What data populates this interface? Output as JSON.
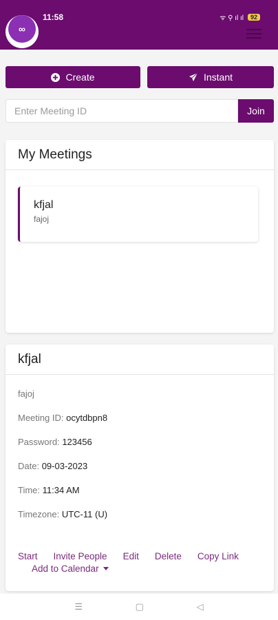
{
  "status_bar": {
    "time": "11:58",
    "signal_text": "ᯤ ⚲ ıl ıl",
    "battery": "92"
  },
  "actions": {
    "create_label": "Create",
    "instant_label": "Instant"
  },
  "join": {
    "placeholder": "Enter Meeting ID",
    "button_label": "Join"
  },
  "my_meetings": {
    "title": "My Meetings",
    "items": [
      {
        "name": "kfjal",
        "description": "fajoj"
      }
    ]
  },
  "details": {
    "title": "kfjal",
    "description": "fajoj",
    "meeting_id_label": "Meeting ID:",
    "meeting_id": "ocytdbpn8",
    "password_label": "Password:",
    "password": "123456",
    "date_label": "Date:",
    "date": "09-03-2023",
    "time_label": "Time:",
    "time": "11:34 AM",
    "timezone_label": "Timezone:",
    "timezone": "UTC-11 (U)",
    "links": {
      "start": "Start",
      "invite": "Invite People",
      "edit": "Edit",
      "delete": "Delete",
      "copy": "Copy Link",
      "calendar": "Add to Calendar"
    }
  },
  "nav": {
    "recent": "☰",
    "home": "▢",
    "back": "◁"
  },
  "colors": {
    "brand": "#6b0c6e",
    "link": "#7a2a7c"
  }
}
